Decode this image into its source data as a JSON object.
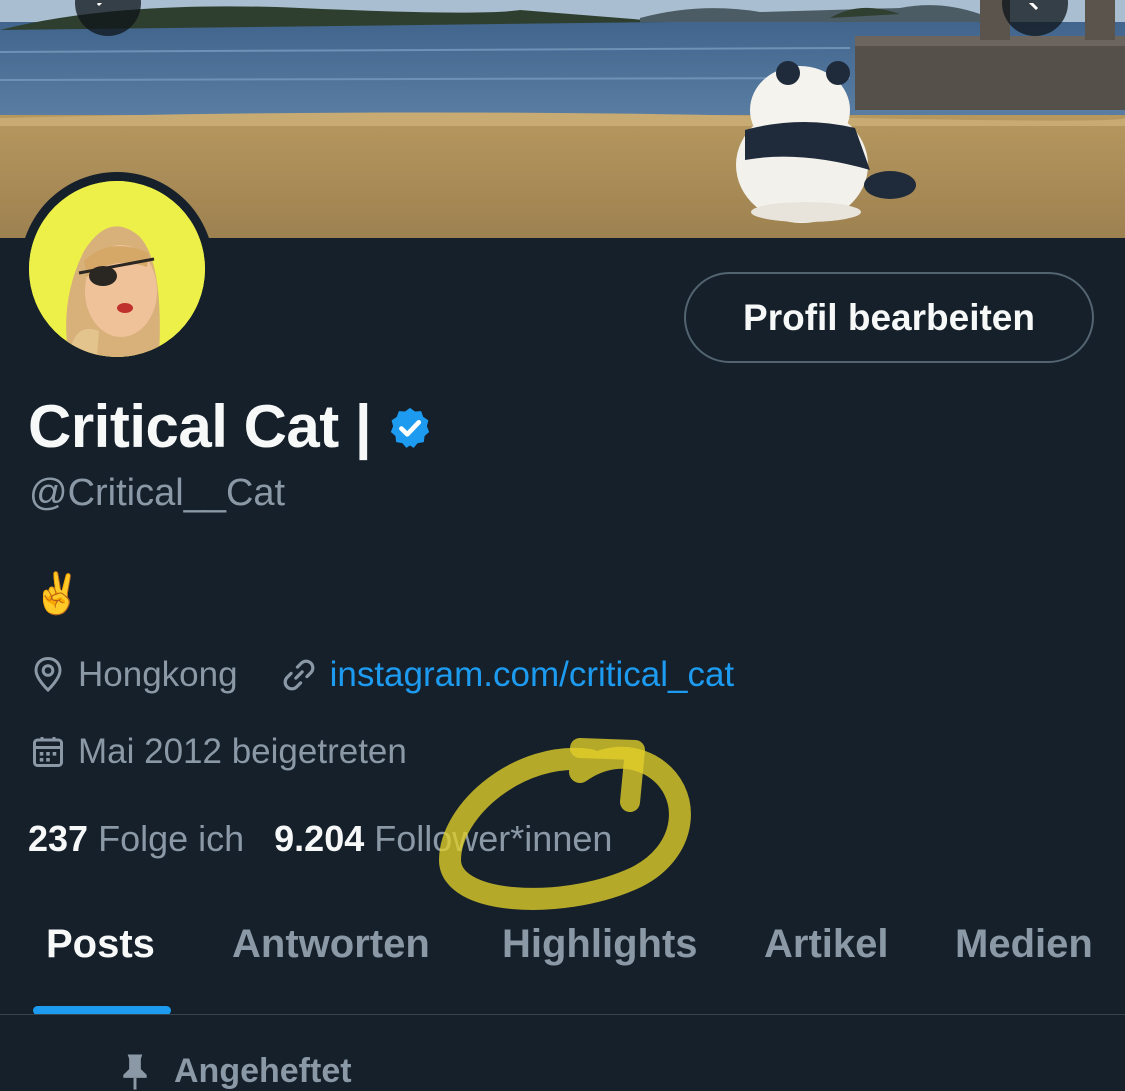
{
  "profile": {
    "display_name": "Critical Cat |",
    "handle": "@Critical__Cat",
    "bio": "✌️",
    "location": "Hongkong",
    "website": "instagram.com/critical_cat",
    "joined": "Mai 2012 beigetreten",
    "following_count": "237",
    "following_label": "Folge ich",
    "followers_count": "9.204",
    "followers_label": "Follower*innen"
  },
  "header": {
    "edit_profile_label": "Profil bearbeiten"
  },
  "tabs": [
    {
      "label": "Posts",
      "active": true
    },
    {
      "label": "Antworten",
      "active": false
    },
    {
      "label": "Highlights",
      "active": false
    },
    {
      "label": "Artikel",
      "active": false
    },
    {
      "label": "Medien",
      "active": false
    }
  ],
  "pinned_label": "Angeheftet",
  "colors": {
    "background": "#15202b",
    "accent": "#1d9bf0",
    "secondary_text": "#8b98a5",
    "highlight_marker": "#e3cf2a"
  }
}
